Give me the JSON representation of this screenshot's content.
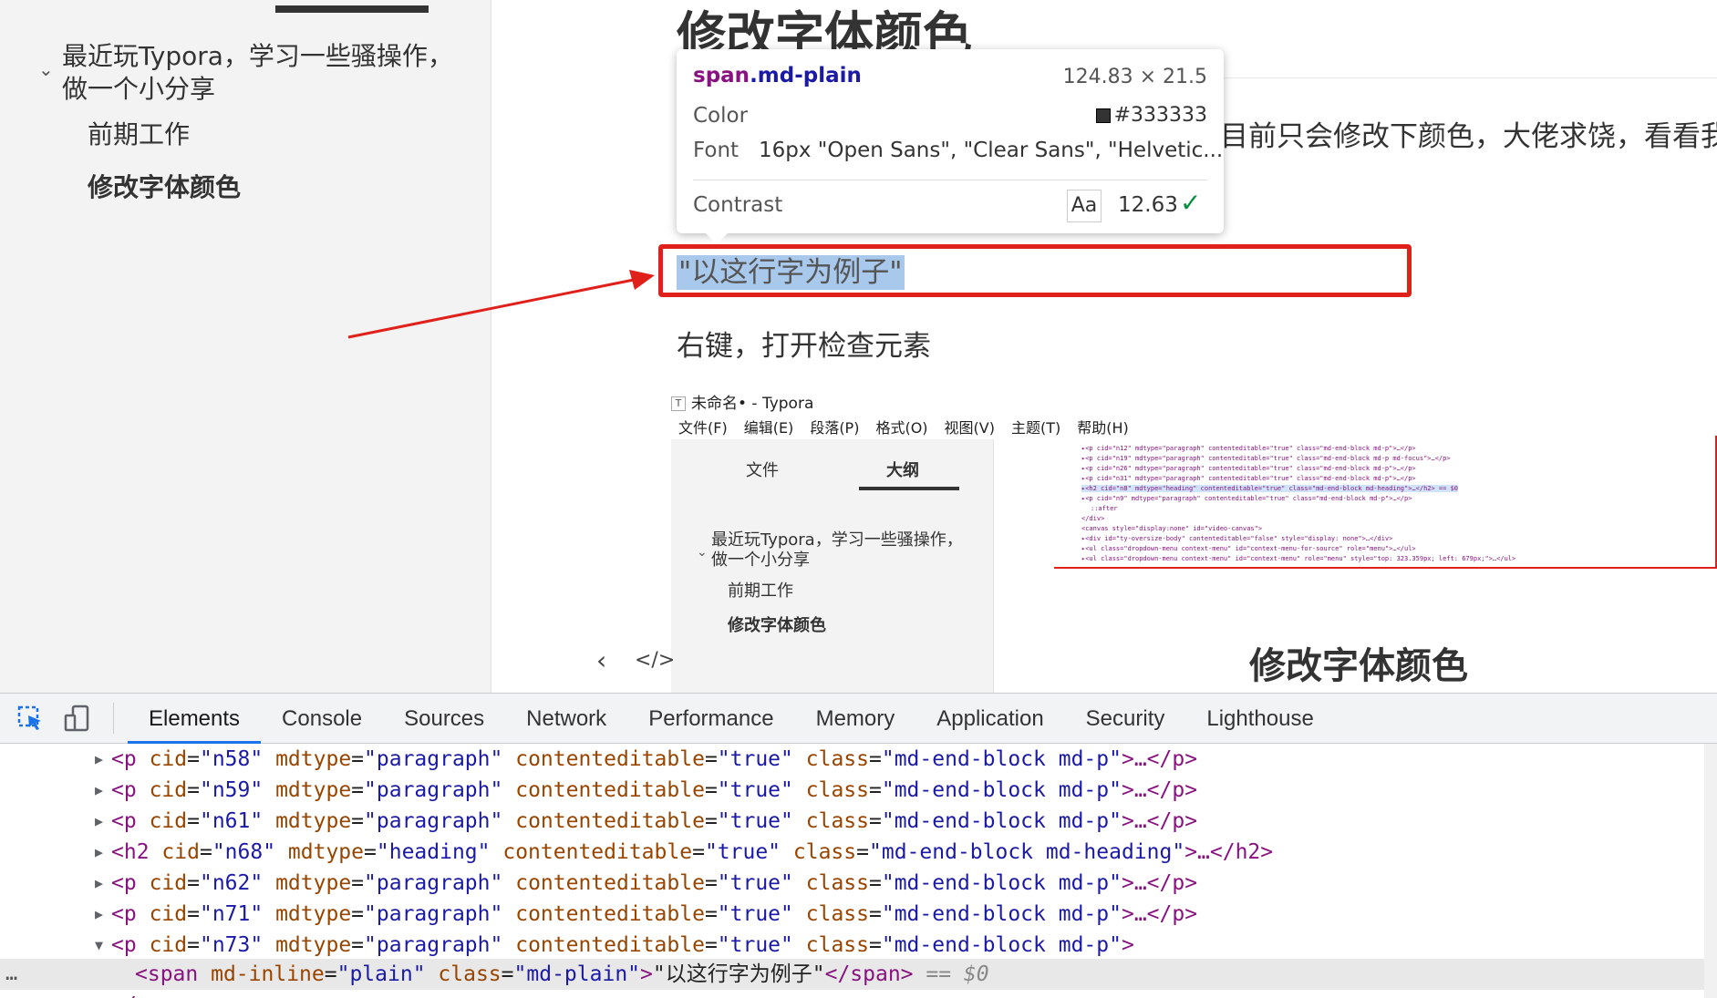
{
  "sidebar": {
    "outline_parent_line1": "最近玩Typora，学习一些骚操作，",
    "outline_parent_line2": "做一个小分享",
    "outline_child_1": "前期工作",
    "outline_child_2": "修改字体颜色"
  },
  "editor": {
    "heading": "修改字体颜色",
    "paragraph_partial": "目前只会修改下颜色，大佬求饶，看看我",
    "example_text": "\"以这行字为例子\"",
    "instruction": "右键，打开检查元素"
  },
  "tooltip": {
    "selector_tag": "span",
    "selector_class": ".md-plain",
    "dimensions": "124.83 × 21.5",
    "color_label": "Color",
    "color_value": "#333333",
    "font_label": "Font",
    "font_value": "16px \"Open Sans\", \"Clear Sans\", \"Helvetic...",
    "contrast_label": "Contrast",
    "contrast_sample": "Aa",
    "contrast_value": "12.63",
    "swatch_color": "#333333"
  },
  "nested": {
    "window_title": "未命名• - Typora",
    "title_icon": "T",
    "menu": [
      "文件(F)",
      "编辑(E)",
      "段落(P)",
      "格式(O)",
      "视图(V)",
      "主题(T)",
      "帮助(H)"
    ],
    "tab_files": "文件",
    "tab_outline": "大纲",
    "outline_parent_line1": "最近玩Typora，学习一些骚操作，",
    "outline_parent_line2": "做一个小分享",
    "outline_child_1": "前期工作",
    "outline_child_2": "修改字体颜色",
    "heading": "修改字体颜色",
    "devtools_lines": [
      "▸<p cid=\"n12\" mdtype=\"paragraph\" contenteditable=\"true\" class=\"md-end-block md-p\">…</p>",
      "▸<p cid=\"n19\" mdtype=\"paragraph\" contenteditable=\"true\" class=\"md-end-block md-p md-focus\">…</p>",
      "▸<p cid=\"n26\" mdtype=\"paragraph\" contenteditable=\"true\" class=\"md-end-block md-p\">…</p>",
      "▸<p cid=\"n31\" mdtype=\"paragraph\" contenteditable=\"true\" class=\"md-end-block md-p\">…</p>",
      "▸<h2 cid=\"n8\" mdtype=\"heading\" contenteditable=\"true\" class=\"md-end-block md-heading\">…</h2> == $0",
      "▸<p cid=\"n9\" mdtype=\"paragraph\" contenteditable=\"true\" class=\"md-end-block md-p\">…</p>",
      "::after",
      "</div>",
      "<canvas style=\"display:none\" id=\"video-canvas\">",
      "▸<div id=\"ty-oversize-body\" contenteditable=\"false\" style=\"display: none\">…</div>",
      "▸<ul class=\"dropdown-menu context-menu\" id=\"context-menu-for-source\" role=\"menu\">…</ul>",
      "▸<ul class=\"dropdown-menu context-menu\" id=\"context-menu\" role=\"menu\" style=\"top: 323.359px; left: 679px;\">…</ul>"
    ]
  },
  "devtools": {
    "tabs": [
      "Elements",
      "Console",
      "Sources",
      "Network",
      "Performance",
      "Memory",
      "Application",
      "Security",
      "Lighthouse"
    ],
    "active_tab": "Elements",
    "code_lines": [
      {
        "toggle": "▶",
        "tag": "p",
        "cid": "n58",
        "mdtype": "paragraph",
        "contenteditable": "true",
        "class": "md-end-block md-p",
        "tail": ">…</p>"
      },
      {
        "toggle": "▶",
        "tag": "p",
        "cid": "n59",
        "mdtype": "paragraph",
        "contenteditable": "true",
        "class": "md-end-block md-p",
        "tail": ">…</p>"
      },
      {
        "toggle": "▶",
        "tag": "p",
        "cid": "n61",
        "mdtype": "paragraph",
        "contenteditable": "true",
        "class": "md-end-block md-p",
        "tail": ">…</p>"
      },
      {
        "toggle": "▶",
        "tag": "h2",
        "cid": "n68",
        "mdtype": "heading",
        "contenteditable": "true",
        "class": "md-end-block md-heading",
        "tail": ">…</h2>"
      },
      {
        "toggle": "▶",
        "tag": "p",
        "cid": "n62",
        "mdtype": "paragraph",
        "contenteditable": "true",
        "class": "md-end-block md-p",
        "tail": ">…</p>"
      },
      {
        "toggle": "▶",
        "tag": "p",
        "cid": "n71",
        "mdtype": "paragraph",
        "contenteditable": "true",
        "class": "md-end-block md-p",
        "tail": ">…</p>"
      },
      {
        "toggle": "▼",
        "tag": "p",
        "cid": "n73",
        "mdtype": "paragraph",
        "contenteditable": "true",
        "class": "md-end-block md-p",
        "tail": ">"
      }
    ],
    "selected_line": {
      "dots": "…",
      "tag": "span",
      "attr1_name": "md-inline",
      "attr1_val": "plain",
      "attr2_name": "class",
      "attr2_val": "md-plain",
      "text": "\"以这行字为例子\"",
      "close": "</span>",
      "marker": "== $0"
    },
    "last_line": "</p>"
  }
}
